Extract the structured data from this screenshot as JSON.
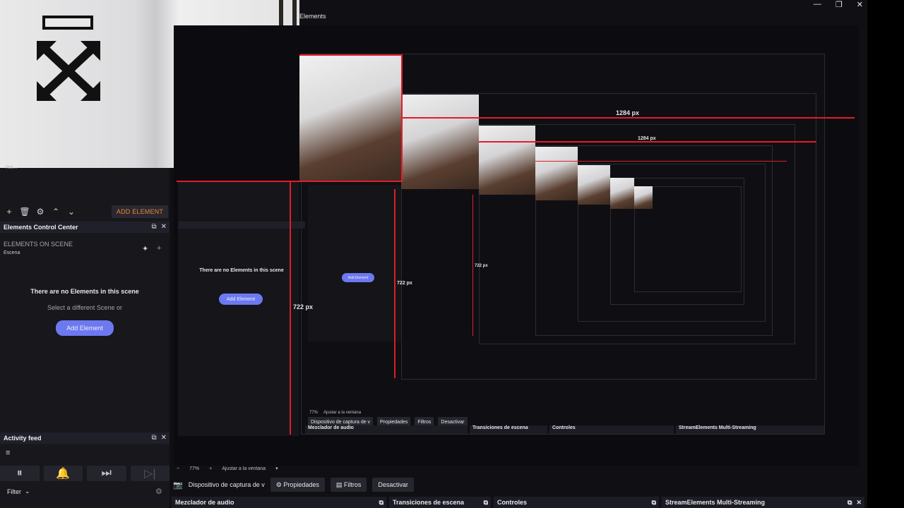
{
  "window": {
    "title": "Elements",
    "controls": [
      "—",
      "❐",
      "✕"
    ]
  },
  "left": {
    "source_item": "Rel...",
    "add_element": "ADD ELEMENT",
    "ecc_title": "Elements Control Center",
    "elements_on_scene": "ELEMENTS ON SCENE",
    "scene_name": "Escena",
    "empty_title": "There are no Elements in this scene",
    "empty_sub": "Select a different Scene or",
    "add_element_btn": "Add Element",
    "activity_title": "Activity feed",
    "filter": "Filter"
  },
  "preview": {
    "measure_w1": "1284 px",
    "measure_w2": "1284 px",
    "measure_h1": "722 px",
    "measure_h2": "722 px",
    "measure_h3": "722 px"
  },
  "nested": {
    "zoom": "77%",
    "fit": "Ajustar a la ventana",
    "capture": "Dispositivo de captura de v",
    "props": "Propiedades",
    "filters": "Filtros",
    "deactivate": "Desactivar",
    "mixer": "Mezclador de audio",
    "transitions": "Transiciones de escena",
    "controls": "Controles",
    "multistream": "StreamElements Multi-Streaming"
  },
  "bottom": {
    "zoom": "77%",
    "fit": "Ajustar a la ventana",
    "capture": "Dispositivo de captura de v",
    "props": "Propiedades",
    "filters": "Filtros",
    "deactivate": "Desactivar",
    "mixer": "Mezclador de audio",
    "transitions": "Transiciones de escena",
    "controls": "Controles",
    "multistream": "StreamElements Multi-Streaming"
  },
  "colors": {
    "accent": "#6d79ef",
    "measure": "#e11d2a",
    "add_element_text": "#e08a3c",
    "panel_bg": "#17171c"
  }
}
